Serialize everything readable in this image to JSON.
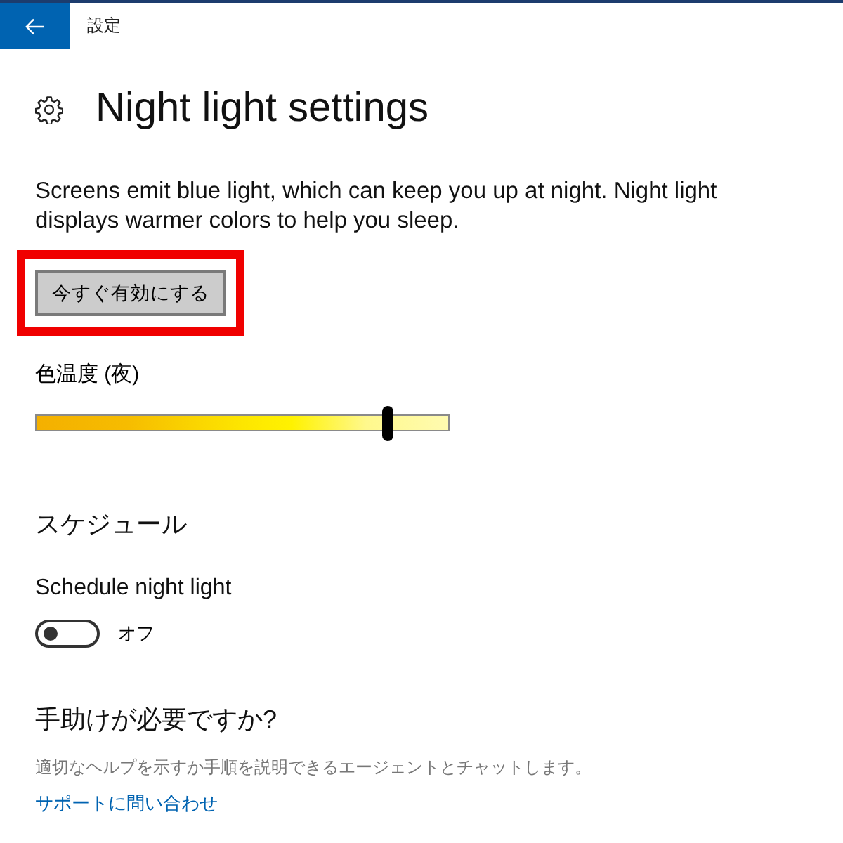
{
  "top_bar": {
    "title": "設定"
  },
  "header": {
    "title": "Night light settings"
  },
  "description": "Screens emit blue light, which can keep you up at night. Night light displays warmer colors to help you sleep.",
  "action_button": {
    "label": "今すぐ有効にする",
    "highlighted": true
  },
  "color_temperature": {
    "label": "色温度 (夜)",
    "level": 0.85
  },
  "schedule": {
    "heading": "スケジュール",
    "label": "Schedule night light",
    "toggle": {
      "on": false,
      "state_label": "オフ"
    }
  },
  "help": {
    "heading": "手助けが必要ですか?",
    "text": "適切なヘルプを示すか手順を説明できるエージェントとチャットします。",
    "link": "サポートに問い合わせ"
  }
}
